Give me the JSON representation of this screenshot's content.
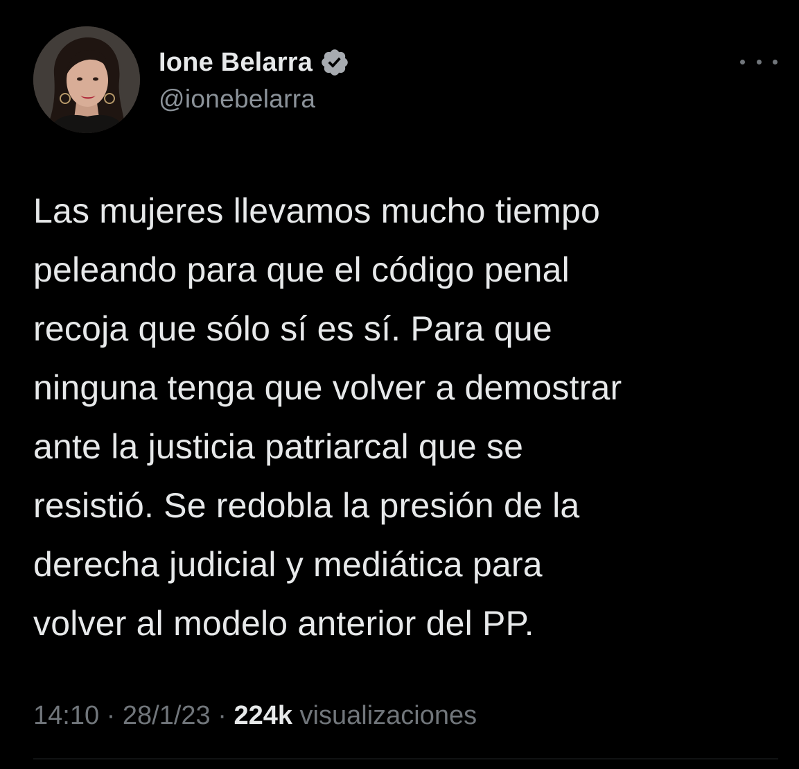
{
  "author": {
    "display_name": "Ione Belarra",
    "handle": "@ionebelarra",
    "verified": true,
    "avatar_icon": "profile-photo"
  },
  "tweet": {
    "text": "Las mujeres llevamos mucho tiempo\npeleando para que el código penal\nrecoja que sólo sí es sí. Para que\nninguna tenga que volver a demostrar\nante la justicia patriarcal que se\nresistió. Se redobla la presión de la\nderecha judicial y mediática para\nvolver al modelo anterior del PP."
  },
  "meta": {
    "time": "14:10",
    "separator": " · ",
    "date": "28/1/23",
    "views_count": "224k",
    "views_label": " visualizaciones"
  },
  "icons": {
    "more": "more-horizontal-icon",
    "verified": "verified-badge-icon"
  },
  "colors": {
    "background": "#000000",
    "primary_text": "#e7e9ea",
    "secondary_text": "#71767b",
    "verified_badge": "#a7abb0"
  }
}
